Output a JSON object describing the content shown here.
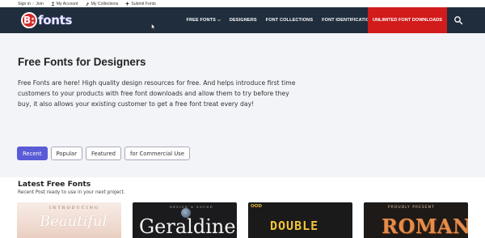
{
  "topbar": {
    "signin_label": "Sign in",
    "join_label": "Join",
    "account_label": "My Account",
    "collections_label": "My Collections",
    "submit_label": "Submit Fonts"
  },
  "nav": {
    "logo_badge": "B:",
    "logo_word": "fonts",
    "links": [
      {
        "label": "FREE FONTS"
      },
      {
        "label": "DESIGNERS"
      },
      {
        "label": "FONT COLLECTIONS"
      },
      {
        "label": "FONT IDENTIFICATION"
      }
    ],
    "cta_label": "UNLIMITED FONT DOWNLOADS",
    "icons": [
      "search-icon"
    ]
  },
  "hero": {
    "title": "Free Fonts for Designers",
    "lines": [
      "Free Fonts are here! High quality design resources for free. And helps introduce first time",
      "customers to your products with free font downloads and allow them to try before they",
      "buy, it also allows your existing customer to get a free font treat every day!"
    ],
    "tabs": [
      {
        "label": "Recent",
        "active": true
      },
      {
        "label": "Popular",
        "active": false
      },
      {
        "label": "Featured",
        "active": false
      },
      {
        "label": "for Commercial Use",
        "active": false
      }
    ]
  },
  "latest": {
    "title": "Latest Free Fonts",
    "subtitle": "Recent Post ready to use in your next project.",
    "cards": [
      {
        "small": "INTRODUCING",
        "big": "Beautiful"
      },
      {
        "small": "DESIGN & SOUND",
        "big": "Geraldine"
      },
      {
        "small": "OOD",
        "big": "DOUBLE"
      },
      {
        "small": "PROUDLY PRESENT",
        "big": "ROMAN"
      }
    ]
  },
  "colors": {
    "nav_bg": "#1f2d3d",
    "cta_bg": "#d21b1b",
    "active_tab": "#5a5bd6",
    "hero_bg": "#f3f4f8"
  }
}
